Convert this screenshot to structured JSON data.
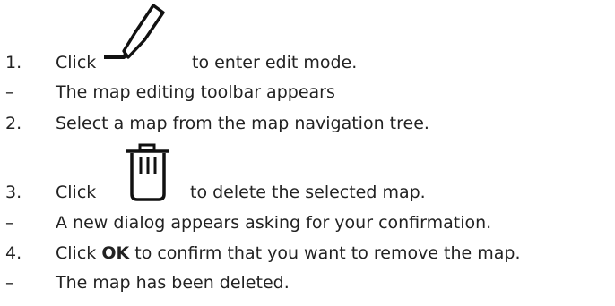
{
  "steps": [
    {
      "marker": "1.",
      "before": "Click",
      "after": "to enter edit mode.",
      "icon": "pencil-edit-icon"
    },
    {
      "marker": "–",
      "text": "The map editing toolbar appears"
    },
    {
      "marker": "2.",
      "text": "Select a map from the map navigation tree."
    },
    {
      "marker": "3.",
      "before": "Click",
      "after": "to delete the selected map.",
      "icon": "trash-bin-icon"
    },
    {
      "marker": "–",
      "text": "A new dialog appears asking for your confirmation."
    },
    {
      "marker": "4.",
      "before": "Click",
      "bold": "OK",
      "after": "to confirm that you want to remove the map."
    },
    {
      "marker": "–",
      "text": "The map has been deleted."
    }
  ],
  "colors": {
    "text": "#222222",
    "icon": "#111111"
  }
}
